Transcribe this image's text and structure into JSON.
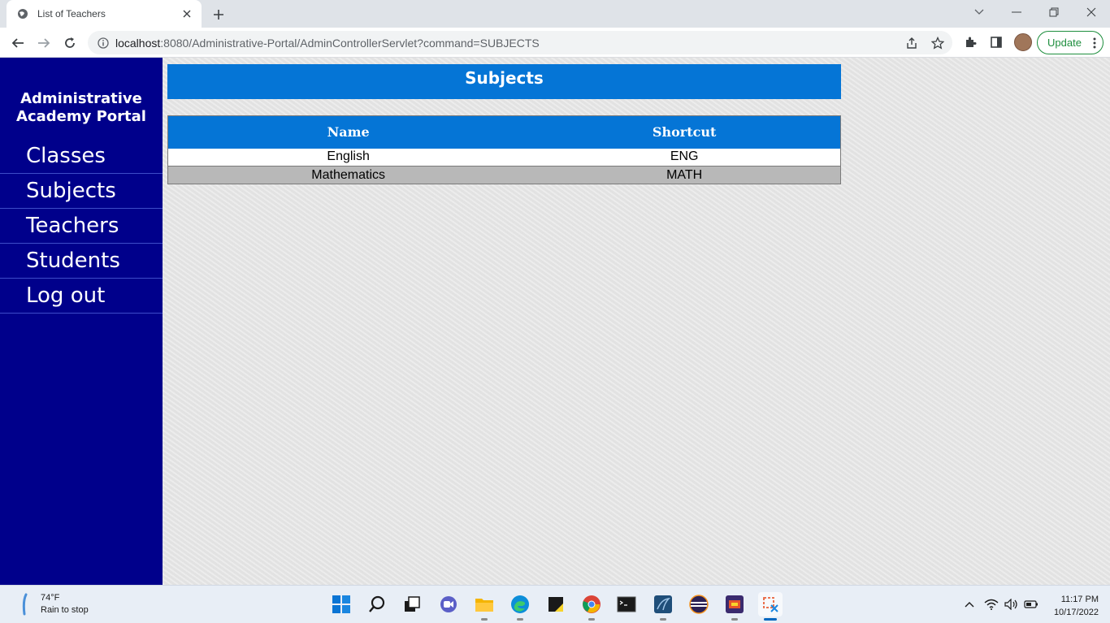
{
  "browser": {
    "tab_title": "List of Teachers",
    "url_host": "localhost",
    "url_rest": ":8080/Administrative-Portal/AdminControllerServlet?command=SUBJECTS",
    "update_label": "Update"
  },
  "sidebar": {
    "brand_line1": "Administrative",
    "brand_line2": "Academy Portal",
    "items": [
      {
        "label": "Classes"
      },
      {
        "label": "Subjects"
      },
      {
        "label": "Teachers"
      },
      {
        "label": "Students"
      },
      {
        "label": "Log out"
      }
    ]
  },
  "main": {
    "heading": "Subjects",
    "table": {
      "headers": [
        "Name",
        "Shortcut"
      ],
      "rows": [
        [
          "English",
          "ENG"
        ],
        [
          "Mathematics",
          "MATH"
        ]
      ]
    }
  },
  "taskbar": {
    "weather_temp": "74°F",
    "weather_desc": "Rain to stop",
    "time": "11:17 PM",
    "date": "10/17/2022"
  },
  "colors": {
    "sidebar_bg": "#00008b",
    "header_blue": "#0575d6",
    "alt_row": "#b8b8b8",
    "update_green": "#1e8e3e"
  }
}
